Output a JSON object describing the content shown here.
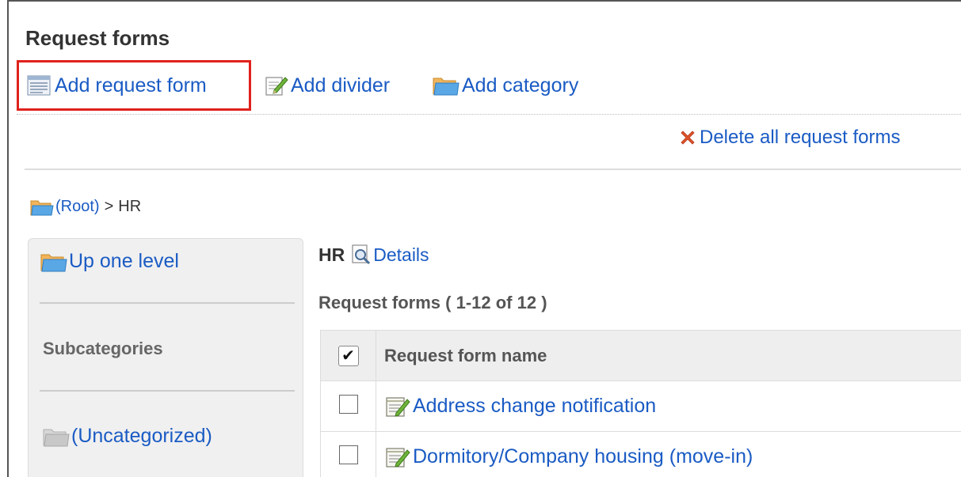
{
  "page": {
    "title": "Request forms"
  },
  "toolbar": {
    "add_request_form": "Add request form",
    "add_divider": "Add divider",
    "add_category": "Add category",
    "highlight_color": "#e0211c"
  },
  "actions": {
    "delete_all": "Delete all request forms"
  },
  "breadcrumb": {
    "root": "(Root)",
    "separator": ">",
    "current": "HR"
  },
  "sidebar": {
    "up_one_level": "Up one level",
    "subcategories_heading": "Subcategories",
    "uncategorized": "(Uncategorized)"
  },
  "main": {
    "category_name": "HR",
    "details_link": "Details",
    "count_text": "Request forms ( 1-12 of 12 )",
    "table": {
      "header_checkbox": "✔",
      "column_name": "Request form name",
      "rows": [
        {
          "name": "Address change notification"
        },
        {
          "name": "Dormitory/Company housing (move-in)"
        }
      ]
    }
  },
  "colors": {
    "link": "#1a5bc4",
    "frame_border": "#555555"
  }
}
